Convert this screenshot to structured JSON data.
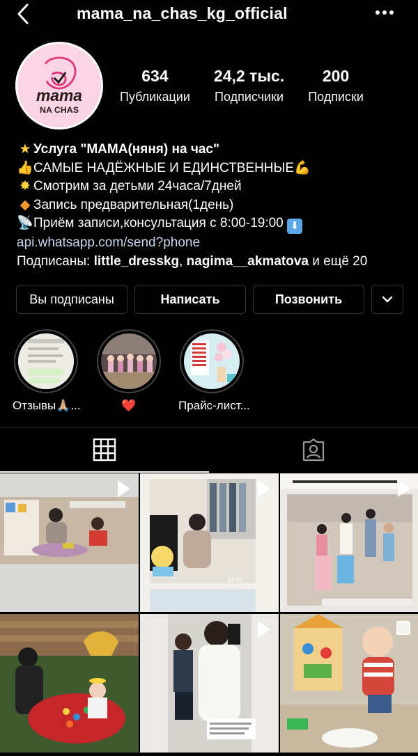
{
  "header": {
    "username": "mama_na_chas_kg_official",
    "back_icon": "chevron-left-icon",
    "more_icon": "more-dots-icon"
  },
  "avatar": {
    "logo_text_top": "mama",
    "logo_text_bottom": "NA CHAS"
  },
  "stats": [
    {
      "count": "634",
      "label": "Публикации"
    },
    {
      "count": "24,2 тыс.",
      "label": "Подписчики"
    },
    {
      "count": "200",
      "label": "Подписки"
    }
  ],
  "bio": {
    "line1": "Услуга \"МАМА(няня) на час\"",
    "line2": "САМЫЕ НАДЁЖНЫЕ И ЕДИНСТВЕННЫЕ",
    "line3": "Смотрим за детьми 24часа/7дней",
    "line4": "Запись предварительная(1день)",
    "line5": "Приём записи,консультация с 8:00-19:00",
    "link": "api.whatsapp.com/send?phone",
    "followed_prefix": "Подписаны: ",
    "followed_user1": "little_dresskg",
    "followed_sep": ", ",
    "followed_user2": "nagima__akmatova",
    "followed_suffix": " и ещё 20"
  },
  "buttons": {
    "following": "Вы подписаны",
    "message": "Написать",
    "call": "Позвонить",
    "dropdown_icon": "chevron-down-icon"
  },
  "highlights": [
    {
      "caption": "Отзывы🙏🏼..."
    },
    {
      "caption": "❤️"
    },
    {
      "caption": "Прайс-лист..."
    }
  ],
  "tabs": {
    "grid_icon": "grid-icon",
    "tagged_icon": "tagged-icon"
  },
  "colors": {
    "background": "#000000",
    "border": "#363636",
    "link": "#c7d8ee",
    "logo_pink": "#e0357a"
  }
}
